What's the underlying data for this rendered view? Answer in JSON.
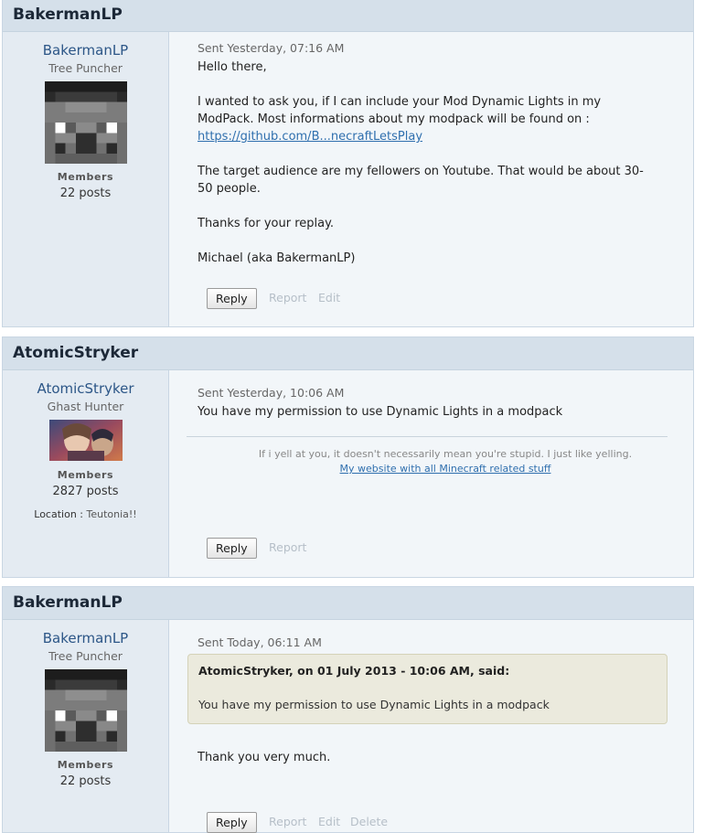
{
  "posts": [
    {
      "header": "BakermanLP",
      "author": {
        "name": "BakermanLP",
        "title": "Tree Puncher",
        "avatar_icon": "creeper-skin-avatar-icon",
        "group": "Members",
        "post_count": "22 posts"
      },
      "sent": "Sent Yesterday, 07:16 AM",
      "body": {
        "line1": "Hello there,",
        "line2": "I wanted to ask you, if I can include your Mod Dynamic Lights in my",
        "line3": "ModPack. Most informations about my modpack will be found on :",
        "link": "https://github.com/B...necraftLetsPlay",
        "line4": "The target audience are my fellowers on Youtube. That would be about 30-",
        "line5": "50 people.",
        "line6": "Thanks for your replay.",
        "line7": "Michael (aka BakermanLP)"
      },
      "actions": {
        "reply": "Reply",
        "report": "Report",
        "edit": "Edit"
      }
    },
    {
      "header": "AtomicStryker",
      "author": {
        "name": "AtomicStryker",
        "title": "Ghast Hunter",
        "avatar_icon": "anime-character-avatar-icon",
        "group": "Members",
        "post_count": "2827 posts",
        "location_label": "Location :",
        "location_value": "Teutonia!!"
      },
      "sent": "Sent Yesterday, 10:06 AM",
      "body": {
        "line1": "You have my permission to use Dynamic Lights in a modpack"
      },
      "signature": {
        "text": "If i yell at you, it doesn't necessarily mean you're stupid. I just like yelling.",
        "link": "My website with all Minecraft related stuff"
      },
      "actions": {
        "reply": "Reply",
        "report": "Report"
      }
    },
    {
      "header": "BakermanLP",
      "author": {
        "name": "BakermanLP",
        "title": "Tree Puncher",
        "avatar_icon": "creeper-skin-avatar-icon",
        "group": "Members",
        "post_count": "22 posts"
      },
      "sent": "Sent Today, 06:11 AM",
      "quote": {
        "citation": "AtomicStryker, on 01 July 2013 - 10:06 AM, said:",
        "text": "You have my permission to use Dynamic Lights in a modpack"
      },
      "body": {
        "line1": "Thank you very much."
      },
      "actions": {
        "reply": "Reply",
        "report": "Report",
        "edit": "Edit",
        "delete": "Delete"
      }
    }
  ],
  "colors": {
    "header_bg": "#d5e0ea",
    "author_bg": "#e4ebf2",
    "content_bg": "#f2f6f9",
    "link": "#2f6fae",
    "name": "#2c5687",
    "quote_bg": "#ebeadd"
  }
}
